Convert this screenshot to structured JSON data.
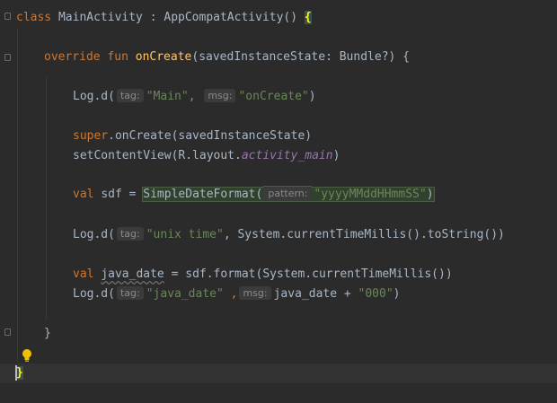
{
  "editor": {
    "icons": {
      "fold": "fold-marker-icon",
      "bulb": "intention-bulb-icon"
    },
    "l1": {
      "kw_class": "class",
      "class_name": " MainActivity : AppCompatActivity() ",
      "brace": "{"
    },
    "l2": {
      "kw": "override fun ",
      "fn": "onCreate",
      "rest": "(savedInstanceState: Bundle?) {"
    },
    "l3": {
      "call": "Log.d(",
      "hint1": "tag:",
      "str1": "\"Main\"",
      "comma": ", ",
      "hint2": "msg:",
      "str2": "\"onCreate\"",
      "close": ")"
    },
    "l4": {
      "kw": "super",
      "rest": ".onCreate(savedInstanceState)"
    },
    "l5": {
      "pre": "setContentView(R.layout.",
      "ref": "activity_main",
      "close": ")"
    },
    "l6": {
      "kw": "val ",
      "name": "sdf = ",
      "call": "SimpleDateFormat(",
      "hint": "pattern:",
      "str": "\"yyyyMMddHHmmSS\"",
      "close": ")"
    },
    "l7": {
      "call": "Log.d(",
      "hint": "tag:",
      "str": "\"unix time\"",
      "rest": ", System.currentTimeMillis().toString())"
    },
    "l8": {
      "kw": "val ",
      "var": "java_date",
      "rest": " = sdf.format(System.currentTimeMillis())"
    },
    "l9": {
      "call": "Log.d(",
      "hint1": "tag:",
      "str1": "\"java_date\"",
      "comma": " ,",
      "hint2": "msg:",
      "mid": "java_date + ",
      "str2": "\"000\"",
      "close": ")"
    },
    "l10": {
      "brace": "}"
    },
    "l11": {
      "brace": "}"
    }
  }
}
